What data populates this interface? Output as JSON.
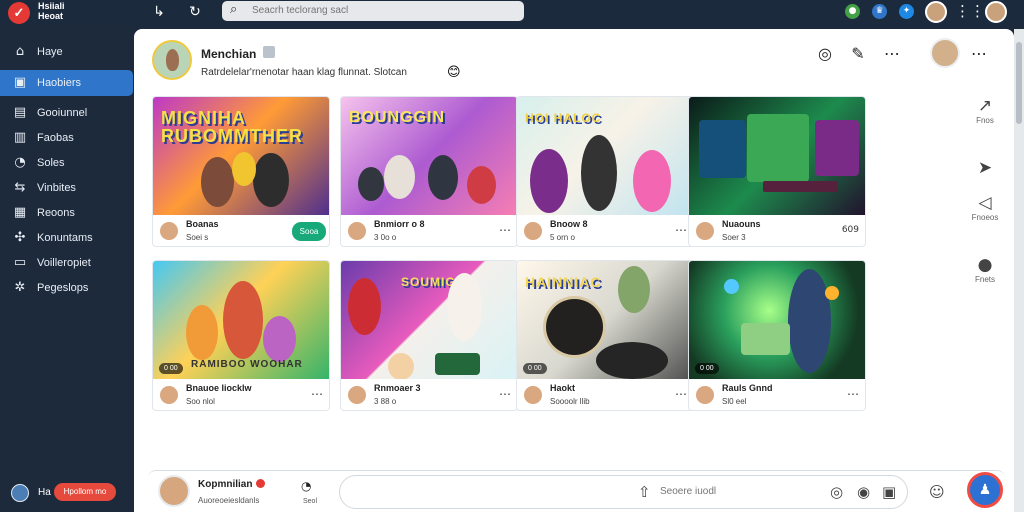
{
  "app": {
    "logo_text": "Hsiiali\nHeoat"
  },
  "topbar": {
    "search_placeholder": "Seacrh teclorang sacl",
    "search_icon": "search-icon",
    "back_icon": "back-icon",
    "refresh_icon": "refresh-icon",
    "notification_icons": [
      "green-app-icon",
      "blue-app-icon",
      "bird-app-icon"
    ],
    "apps_icon": "apps-grid-icon"
  },
  "sidebar": {
    "items": [
      {
        "label": "Haye",
        "icon": "home-icon"
      },
      {
        "label": "Haobiers",
        "icon": "video-icon",
        "active": true
      },
      {
        "label": "Gooiunnel",
        "icon": "channel-icon"
      },
      {
        "label": "Faobas",
        "icon": "book-icon"
      },
      {
        "label": "Soles",
        "icon": "chat-icon"
      },
      {
        "label": "Vinbites",
        "icon": "share-icon"
      },
      {
        "label": "Reoons",
        "icon": "rooms-icon"
      },
      {
        "label": "Konuntams",
        "icon": "puzzle-icon"
      },
      {
        "label": "Voilleropiet",
        "icon": "folder-icon"
      },
      {
        "label": "Pegeslops",
        "icon": "settings-icon"
      }
    ],
    "footer": {
      "name": "Ha",
      "badge": "Hpollom mo"
    }
  },
  "post": {
    "author": "Menchian",
    "body": "Ratrdelelar'rnenotar haan klag flunnat. Slotcan",
    "emoji": "😊",
    "actions": [
      "camera-icon",
      "edit-icon",
      "more-icon"
    ]
  },
  "cards": [
    {
      "art_title": "MIGNIHA RUBOMMTHER",
      "title": "Boanas",
      "meta": "Soei s",
      "avatar": "avatar",
      "badge": "Sooa",
      "accent": "#f0b52a"
    },
    {
      "art_title": "BOUNGGIN",
      "title": "Bnmiorr o 8",
      "meta": "3 0o o",
      "avatar": "avatar",
      "accent": "#ea69b5"
    },
    {
      "art_title": "HOI HALOC",
      "title": "Bnoow 8",
      "meta": "5 orn o",
      "avatar": "avatar",
      "accent": "#9d4ed8"
    },
    {
      "art_title": "",
      "title": "Nuaouns",
      "meta": "Soer 3",
      "avatar": "avatar",
      "right_meta": "609",
      "accent": "#2d8b4b"
    },
    {
      "art_title": "RAMIBOO WOOHAR",
      "title": "Bnauoe liocklw",
      "meta": "Soo nlol",
      "avatar": "avatar",
      "duration": "0 00",
      "accent": "#31b4e8"
    },
    {
      "art_title": "SOUMIG",
      "title": "Rnmoaer 3",
      "meta": "3 88 o",
      "avatar": "avatar",
      "accent": "#8a57b8"
    },
    {
      "art_title": "HAINNIAC",
      "title": "Haokt",
      "meta": "Soooolr llib",
      "avatar": "avatar",
      "duration": "0 00",
      "accent": "#f5d15e"
    },
    {
      "art_title": "",
      "title": "Rauls Gnnd",
      "meta": "Sl0 eel",
      "avatar": "avatar",
      "duration": "0 00",
      "accent": "#2ebf76"
    }
  ],
  "rail": [
    {
      "label": "Fnos",
      "icon": "share-icon"
    },
    {
      "label": "",
      "icon": "pointer-icon"
    },
    {
      "label": "Fnoeos",
      "icon": "send-icon"
    },
    {
      "label": "Fnets",
      "icon": "circle-icon"
    }
  ],
  "composer": {
    "name": "Kopmnilian",
    "subtitle": "Auoreoeiesldanls",
    "tool_label": "Seol",
    "placeholder": "Seoere iuodl",
    "icons": [
      "message-icon",
      "sticker-icon",
      "image-icon",
      "emoji-icon"
    ]
  },
  "colors": {
    "topbar": "#1c2a3d",
    "sidebar": "#1d2a3c",
    "active": "#2f75c9",
    "main_background": "#ffffff",
    "live": "#18a97a",
    "alert": "#e64a3c",
    "send": "#2d72d2"
  }
}
